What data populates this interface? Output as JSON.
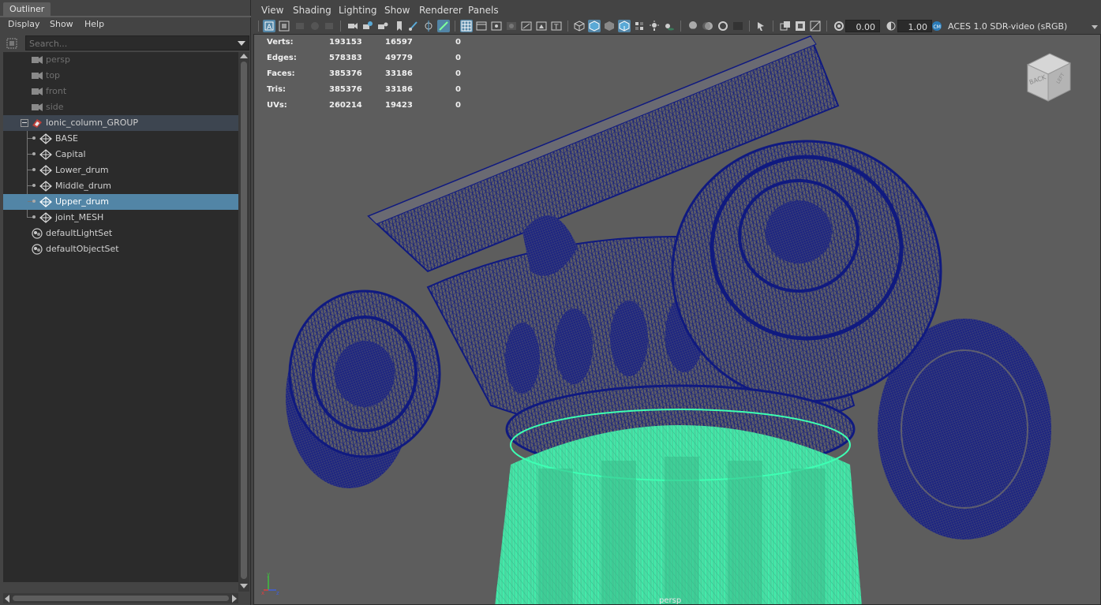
{
  "outliner": {
    "tab_label": "Outliner",
    "menu": [
      "Display",
      "Show",
      "Help"
    ],
    "search_placeholder": "Search...",
    "items": [
      {
        "label": "persp",
        "kind": "camera"
      },
      {
        "label": "top",
        "kind": "camera"
      },
      {
        "label": "front",
        "kind": "camera"
      },
      {
        "label": "side",
        "kind": "camera"
      },
      {
        "label": "Ionic_column_GROUP",
        "kind": "group"
      },
      {
        "label": "BASE",
        "kind": "mesh"
      },
      {
        "label": "Capital",
        "kind": "mesh"
      },
      {
        "label": "Lower_drum",
        "kind": "mesh"
      },
      {
        "label": "Middle_drum",
        "kind": "mesh"
      },
      {
        "label": "Upper_drum",
        "kind": "mesh",
        "selected": true
      },
      {
        "label": "joint_MESH",
        "kind": "mesh"
      },
      {
        "label": "defaultLightSet",
        "kind": "set"
      },
      {
        "label": "defaultObjectSet",
        "kind": "set"
      }
    ]
  },
  "viewport": {
    "menu": [
      "View",
      "Shading",
      "Lighting",
      "Show",
      "Renderer",
      "Panels"
    ],
    "exposure": "0.00",
    "gamma": "1.00",
    "color_management": "ACES 1.0 SDR-video (sRGB)",
    "camera_name": "persp",
    "viewcube": {
      "face_front": "BACK",
      "face_side": "LEFT"
    },
    "hud": [
      {
        "label": "Verts:",
        "v1": "193153",
        "v2": "16597",
        "v3": "0"
      },
      {
        "label": "Edges:",
        "v1": "578383",
        "v2": "49779",
        "v3": "0"
      },
      {
        "label": "Faces:",
        "v1": "385376",
        "v2": "33186",
        "v3": "0"
      },
      {
        "label": "Tris:",
        "v1": "385376",
        "v2": "33186",
        "v3": "0"
      },
      {
        "label": "UVs:",
        "v1": "260214",
        "v2": "19423",
        "v3": "0"
      }
    ],
    "axis": {
      "x": "x",
      "y": "y",
      "z": "z"
    },
    "colors": {
      "wireframe": "#101a80",
      "selection": "#3dffb3",
      "background": "#5d5d5d",
      "highlight": "#5285a6"
    }
  }
}
